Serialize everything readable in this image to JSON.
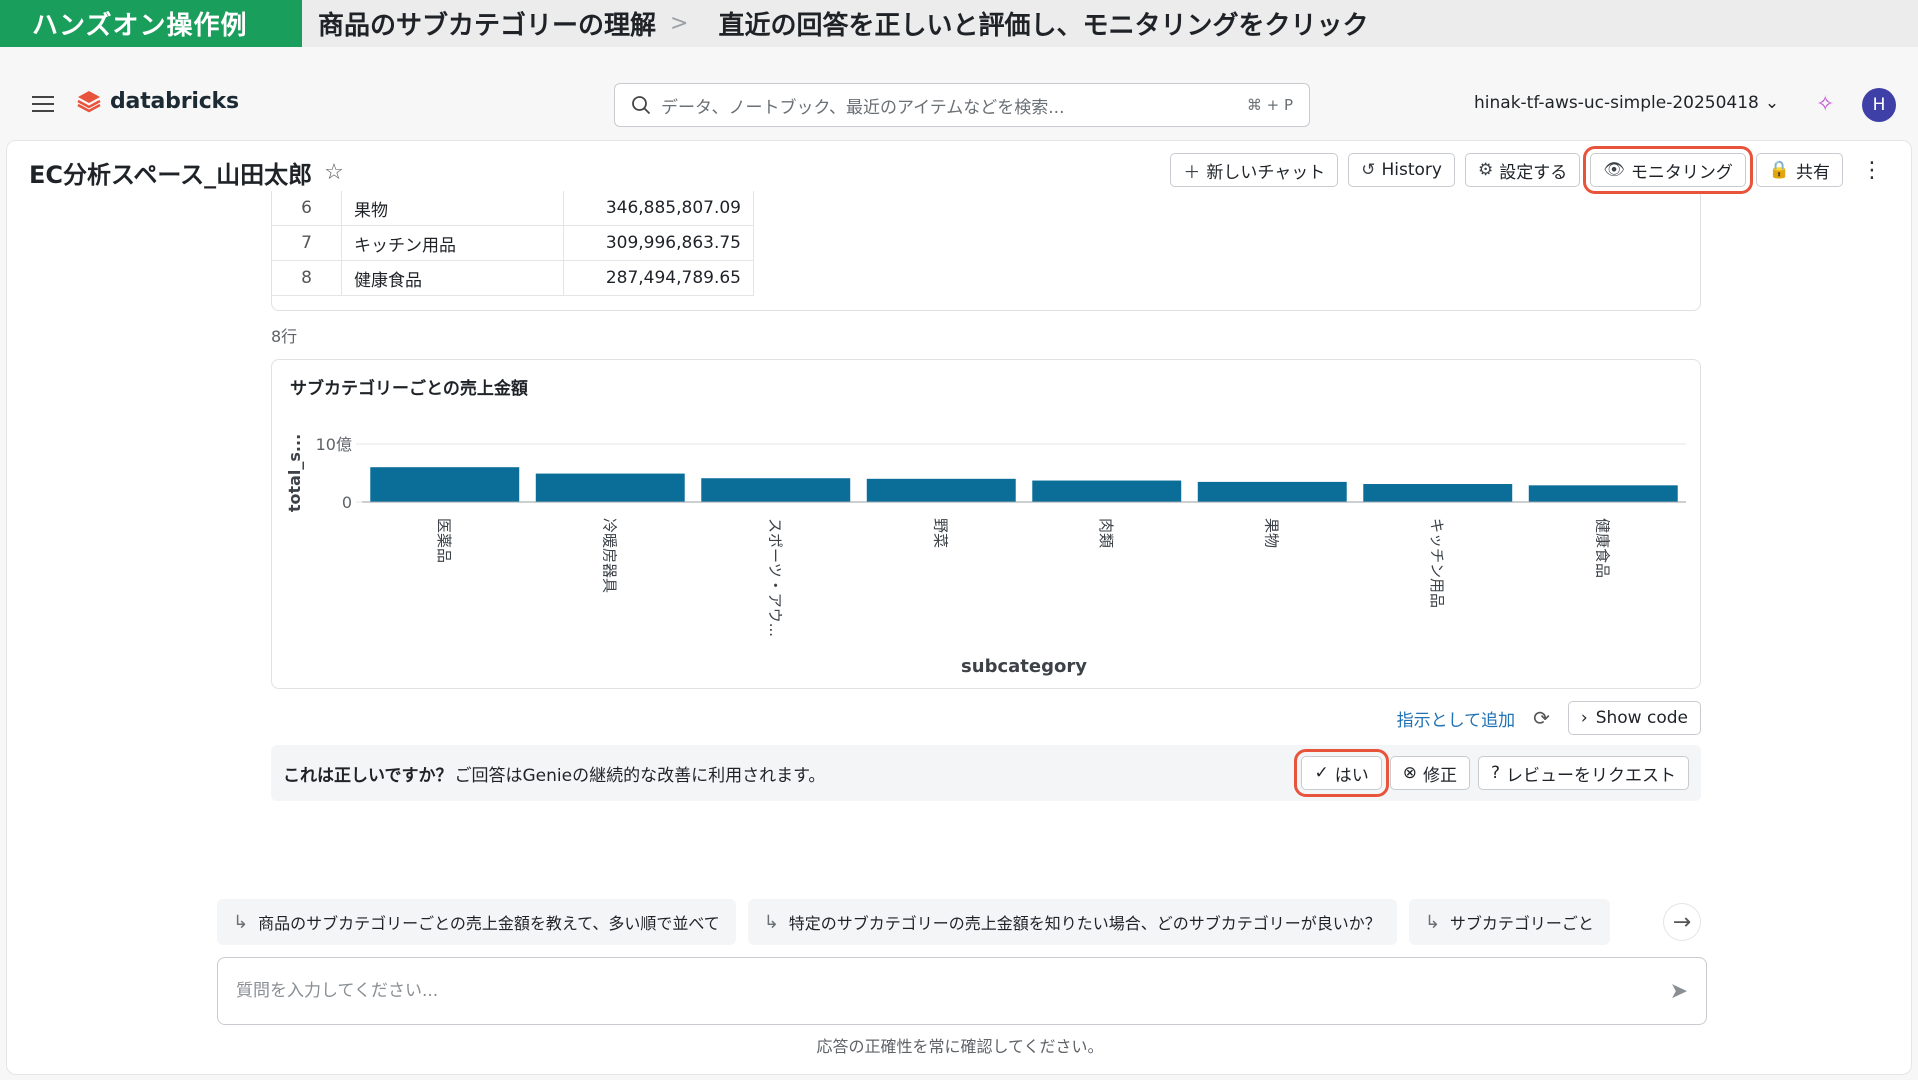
{
  "banner": {
    "tag": "ハンズオン操作例",
    "crumb1": "商品のサブカテゴリーの理解",
    "separator": ">",
    "crumb2": "直近の回答を正しいと評価し、モニタリングをクリック"
  },
  "nav": {
    "logo": "databricks",
    "search_placeholder": "データ、ノートブック、最近のアイテムなどを検索...",
    "search_shortcut": "⌘ + P",
    "workspace": "hinak-tf-aws-uc-simple-20250418",
    "avatar_initial": "H"
  },
  "header": {
    "title": "EC分析スペース_山田太郎",
    "buttons": {
      "new_chat": "新しいチャット",
      "history": "History",
      "settings": "設定する",
      "monitoring": "モニタリング",
      "share": "共有"
    }
  },
  "table": {
    "rows": [
      {
        "idx": "6",
        "name": "果物",
        "value": "346,885,807.09"
      },
      {
        "idx": "7",
        "name": "キッチン用品",
        "value": "309,996,863.75"
      },
      {
        "idx": "8",
        "name": "健康食品",
        "value": "287,494,789.65"
      }
    ],
    "row_count": "8行"
  },
  "chart_data": {
    "type": "bar",
    "title": "サブカテゴリーごとの売上金額",
    "xlabel": "subcategory",
    "ylabel": "total_s...",
    "y_ticks": [
      "0",
      "10億"
    ],
    "ylim": [
      0,
      1000000000
    ],
    "categories": [
      "医薬品",
      "冷暖房器具",
      "スポーツ・アウ...",
      "野菜",
      "肉類",
      "果物",
      "キッチン用品",
      "健康食品"
    ],
    "values": [
      600000000,
      490000000,
      410000000,
      400000000,
      370000000,
      346885807.09,
      309996863.75,
      287494789.65
    ],
    "bar_color": "#0b6e99",
    "grid": true
  },
  "actions": {
    "add_instruction": "指示として追加",
    "show_code": "Show code"
  },
  "feedback": {
    "question": "これは正しいですか？",
    "note": "ご回答はGenieの継続的な改善に利用されます。",
    "yes": "はい",
    "fix": "修正",
    "review": "レビューをリクエスト"
  },
  "suggestions": [
    "商品のサブカテゴリーごとの売上金額を教えて、多い順で並べて",
    "特定のサブカテゴリーの売上金額を知りたい場合、どのサブカテゴリーが良いか？",
    "サブカテゴリーごと"
  ],
  "composer": {
    "placeholder": "質問を入力してください...",
    "disclaimer": "応答の正確性を常に確認してください。"
  },
  "colors": {
    "banner_green": "#1a9e5c",
    "highlight": "#e8533b",
    "link": "#2272b4",
    "bar": "#0b6e99"
  }
}
